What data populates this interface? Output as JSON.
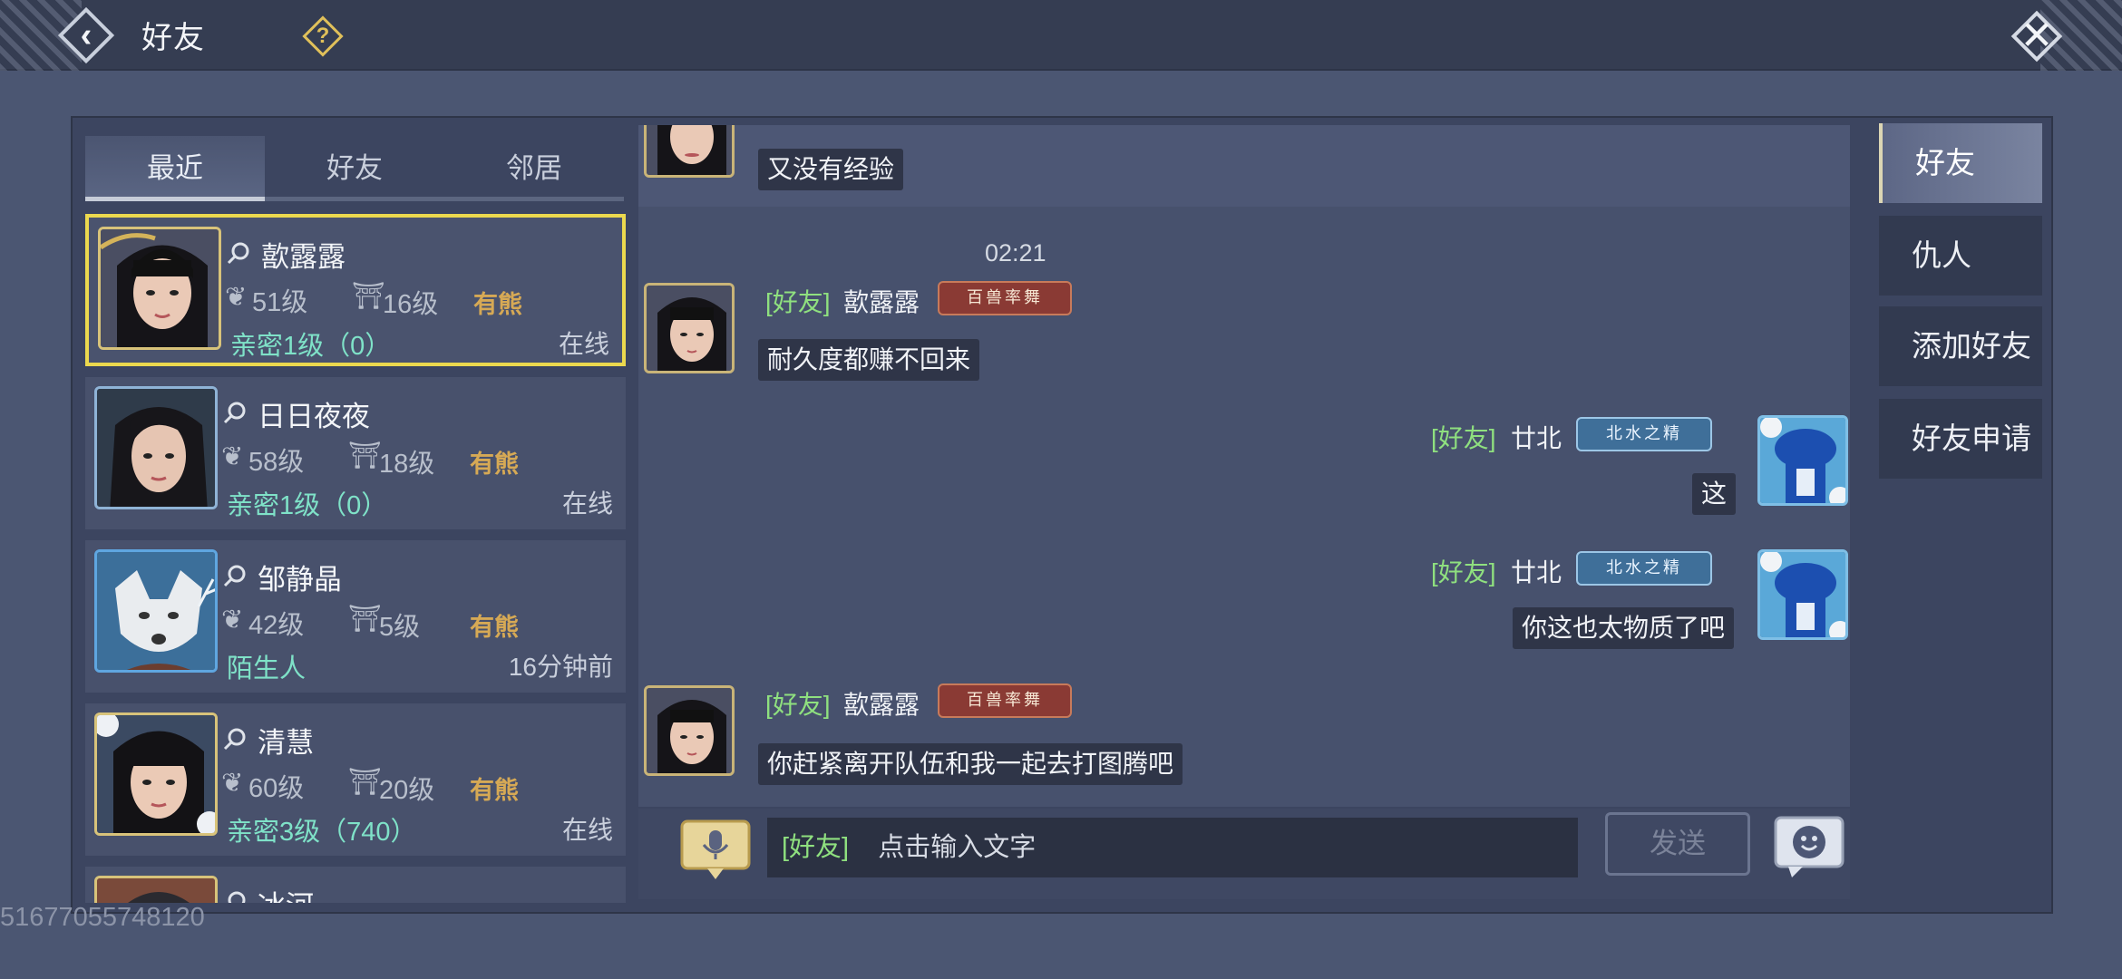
{
  "header": {
    "title": "好友",
    "help_label": "?"
  },
  "friend_tabs": [
    {
      "label": "最近",
      "active": true
    },
    {
      "label": "好友",
      "active": false
    },
    {
      "label": "邻居",
      "active": false
    }
  ],
  "friends": [
    {
      "name": "歖露露",
      "level": "51级",
      "house_level": "16级",
      "tag": "有熊",
      "relation": "亲密1级（0）",
      "status": "在线"
    },
    {
      "name": "日日夜夜",
      "level": "58级",
      "house_level": "18级",
      "tag": "有熊",
      "relation": "亲密1级（0）",
      "status": "在线"
    },
    {
      "name": "邹静晶",
      "level": "42级",
      "house_level": "5级",
      "tag": "有熊",
      "relation": "陌生人",
      "status": "16分钟前"
    },
    {
      "name": "清慧",
      "level": "60级",
      "house_level": "20级",
      "tag": "有熊",
      "relation": "亲密3级（740）",
      "status": "在线"
    },
    {
      "name": "冰河"
    }
  ],
  "chat": {
    "messages": [
      {
        "text": "又没有经验"
      },
      {
        "time": "02:21"
      },
      {
        "tag": "[好友]",
        "name": "歖露露",
        "badge": "百兽率舞",
        "text": "耐久度都赚不回来"
      },
      {
        "tag": "[好友]",
        "name": "廿北",
        "badge": "北水之精",
        "text": "这"
      },
      {
        "tag": "[好友]",
        "name": "廿北",
        "badge": "北水之精",
        "text": "你这也太物质了吧"
      },
      {
        "tag": "[好友]",
        "name": "歖露露",
        "badge": "百兽率舞",
        "text": "你赶紧离开队伍和我一起去打图腾吧"
      }
    ],
    "input_tag": "[好友]",
    "input_placeholder": "点击输入文字",
    "send_label": "发送"
  },
  "side_tabs": [
    {
      "label": "好友",
      "active": true
    },
    {
      "label": "仇人",
      "active": false
    },
    {
      "label": "添加好友",
      "active": false
    },
    {
      "label": "好友申请",
      "active": false
    }
  ],
  "watermark": "51677055748120"
}
